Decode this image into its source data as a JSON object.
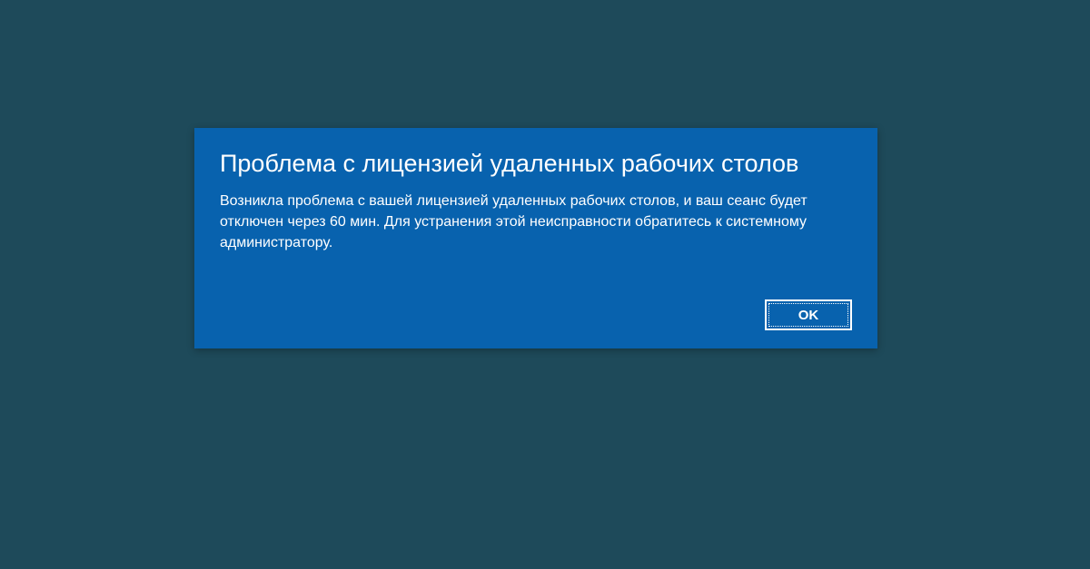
{
  "dialog": {
    "title": "Проблема с лицензией удаленных рабочих столов",
    "message": "Возникла проблема с вашей лицензией удаленных рабочих столов, и ваш сеанс будет отключен через 60 мин. Для устранения этой неисправности обратитесь к системному администратору.",
    "ok_label": "OK"
  },
  "colors": {
    "background": "#1e4a5a",
    "dialog_bg": "#0862ae",
    "text": "#ffffff"
  }
}
